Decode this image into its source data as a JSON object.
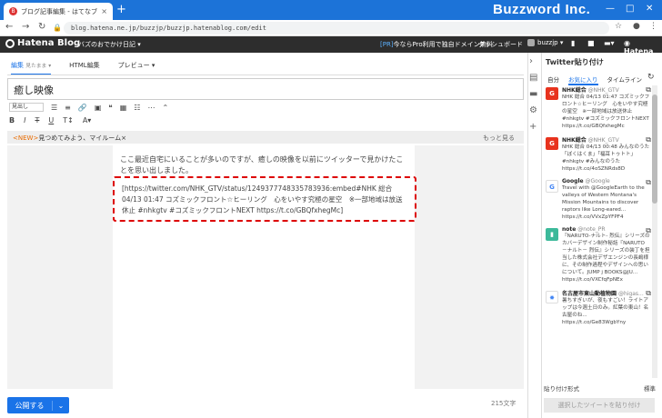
{
  "browser": {
    "tab_title": "ブログ記事編集 - はてなブログ",
    "tab_close": "×",
    "new_tab": "+",
    "brand": "Buzzword Inc.",
    "url": "blog.hatena.ne.jp/buzzjp/buzzjp.hatenablog.com/edit",
    "win_min": "—",
    "win_max": "□",
    "win_close": "✕"
  },
  "header": {
    "logo": "Hatena Blog",
    "blog_name": "バズのおでかけ日記 ▾",
    "pro_prefix": "[PR]",
    "pro_text": "今ならPro利用で独自ドメイン無料",
    "dashboard": "ダッシュボード",
    "user": "buzzjp ▾",
    "hatena": "Hatena"
  },
  "editor": {
    "mode_tabs": [
      {
        "label": "編集",
        "sub": "見たまま ▾"
      },
      {
        "label": "HTML編集"
      },
      {
        "label": "プレビュー ▾"
      }
    ],
    "title": "癒し映像",
    "font_select": "見出し",
    "notice_new": "<NEW>",
    "notice_text": "見つめてみよう、マイルーム×",
    "notice_more": "もっと見る",
    "body_text": "ここ最近自宅にいることが多いのですが、癒しの映像を以前にツイッターで見かけたことを思い出しました。",
    "embed_text": "[https://twitter.com/NHK_GTV/status/1249377748335783936:embed#NHK 総合 04/13 01:47 コズミックフロント☆ヒーリング　心をいやす究極の星空　※一部地域は放送休止 #nhkgtv #コズミックフロントNEXT https://t.co/GBQfxhegMc]",
    "save_label": "公開する",
    "char_count": "215文字"
  },
  "panel": {
    "title": "Twitter貼り付け",
    "tabs": [
      "自分",
      "お気に入り",
      "タイムライン"
    ],
    "tweets": [
      {
        "icon": "G",
        "color": "#e8331e",
        "name": "NHK総合",
        "handle": "@NHK_GTV",
        "body": "NHK 総合 04/13 01:47 コズミックフロント☆ヒーリング　心をいやす究極の星空　※一部地域は放送休止 #nhkgtv #コズミックフロントNEXT https://t.co/GBQfxhegMc"
      },
      {
        "icon": "G",
        "color": "#e8331e",
        "name": "NHK総合",
        "handle": "@NHK_GTV",
        "body": "NHK 総合 04/13 00:48 みんなのうた「ぼくはくま」「福耳トゥトト」 #nhkgtv #みんなのうた https://t.co/4oSZNRds8D"
      },
      {
        "icon": "G",
        "color": "#ffffff",
        "name": "Google",
        "handle": "@Google",
        "body": "Travel with @GoogleEarth to the valleys of Western Montana's Mission Mountains to discover raptors like Long-eared... https://t.co/VVxZpYFPF4"
      },
      {
        "icon": "▮",
        "color": "#3cb99a",
        "name": "note",
        "handle": "@note_PR",
        "body": "『NARUTO-ナルト- 烈伝』シリーズのカバーデザイン制作秘話『NARUTO －ナルト－ 烈伝』シリーズの装丁を担当した株式会社デザエンジンの長嶋様に、その制作過程やデザインへの思いについて。JUMP j BOOKS@JU... https://t.co/VXCfqFpNEx"
      },
      {
        "icon": "✸",
        "color": "#ffffff",
        "name": "名古屋市東山動植物園",
        "handle": "@higas...",
        "body": "暑ちすぎいが、夜もすごい！ライトアップは今週土日のみ。紅葉の東山！名古屋のね... https://t.co/Ge83WgbYny"
      }
    ],
    "format_label": "貼り付け形式",
    "format_value": "標準",
    "paste_button": "選択したツイートを貼り付け"
  }
}
